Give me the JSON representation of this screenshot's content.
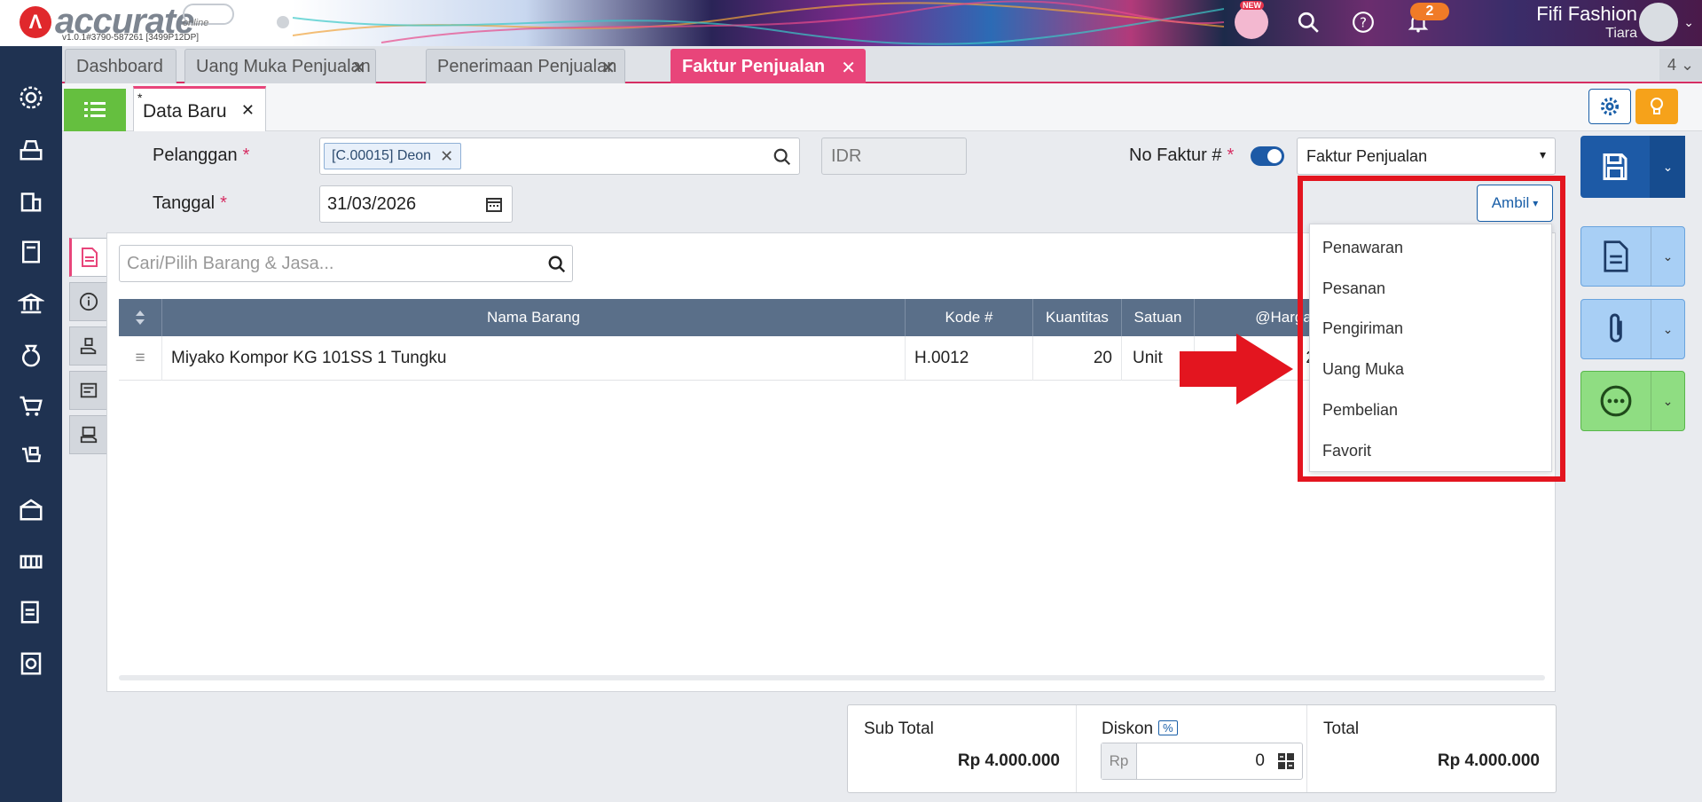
{
  "header": {
    "logo_letter": "Λ",
    "brand": "accurate",
    "brand_sub": "online",
    "version": "v1.0.1#3790-587261 [3499P12DP]",
    "new_badge": "NEW",
    "notifications_count": "2",
    "user_name": "Fifi Fashion",
    "user_company": "Tiara"
  },
  "tabs": [
    {
      "label": "Dashboard"
    },
    {
      "label": "Uang Muka Penjualan"
    },
    {
      "label": "Penerimaan Penjualan"
    },
    {
      "label": "Faktur Penjualan"
    }
  ],
  "tab_count": "4",
  "subtab": {
    "asterisk": "*",
    "label": "Data Baru"
  },
  "form": {
    "customer_label": "Pelanggan",
    "customer_value": "[C.00015] Deon",
    "currency": "IDR",
    "invoice_no_label": "No Faktur #",
    "invoice_type": "Faktur Penjualan",
    "date_label": "Tanggal",
    "date_value": "31/03/2026",
    "required_mark": "*",
    "ambil_label": "Ambil"
  },
  "item_search_placeholder": "Cari/Pilih Barang & Jasa...",
  "table": {
    "columns": [
      "Nama Barang",
      "Kode #",
      "Kuantitas",
      "Satuan",
      "@Harga"
    ],
    "rows": [
      {
        "name": "Miyako Kompor KG 101SS 1 Tungku",
        "code": "H.0012",
        "qty": "20",
        "unit": "Unit",
        "price": "200.000"
      }
    ]
  },
  "ambil_menu": [
    "Penawaran",
    "Pesanan",
    "Pengiriman",
    "Uang Muka",
    "Pembelian",
    "Favorit"
  ],
  "totals": {
    "subtotal_label": "Sub Total",
    "subtotal_value": "Rp 4.000.000",
    "discount_label": "Diskon",
    "discount_pct": "%",
    "discount_currency": "Rp",
    "discount_value": "0",
    "total_label": "Total",
    "total_value": "Rp 4.000.000"
  },
  "colors": {
    "sidebar": "#1f3251",
    "active_tab": "#e8457a",
    "primary": "#1d5aa6",
    "highlight": "#e3151f"
  }
}
